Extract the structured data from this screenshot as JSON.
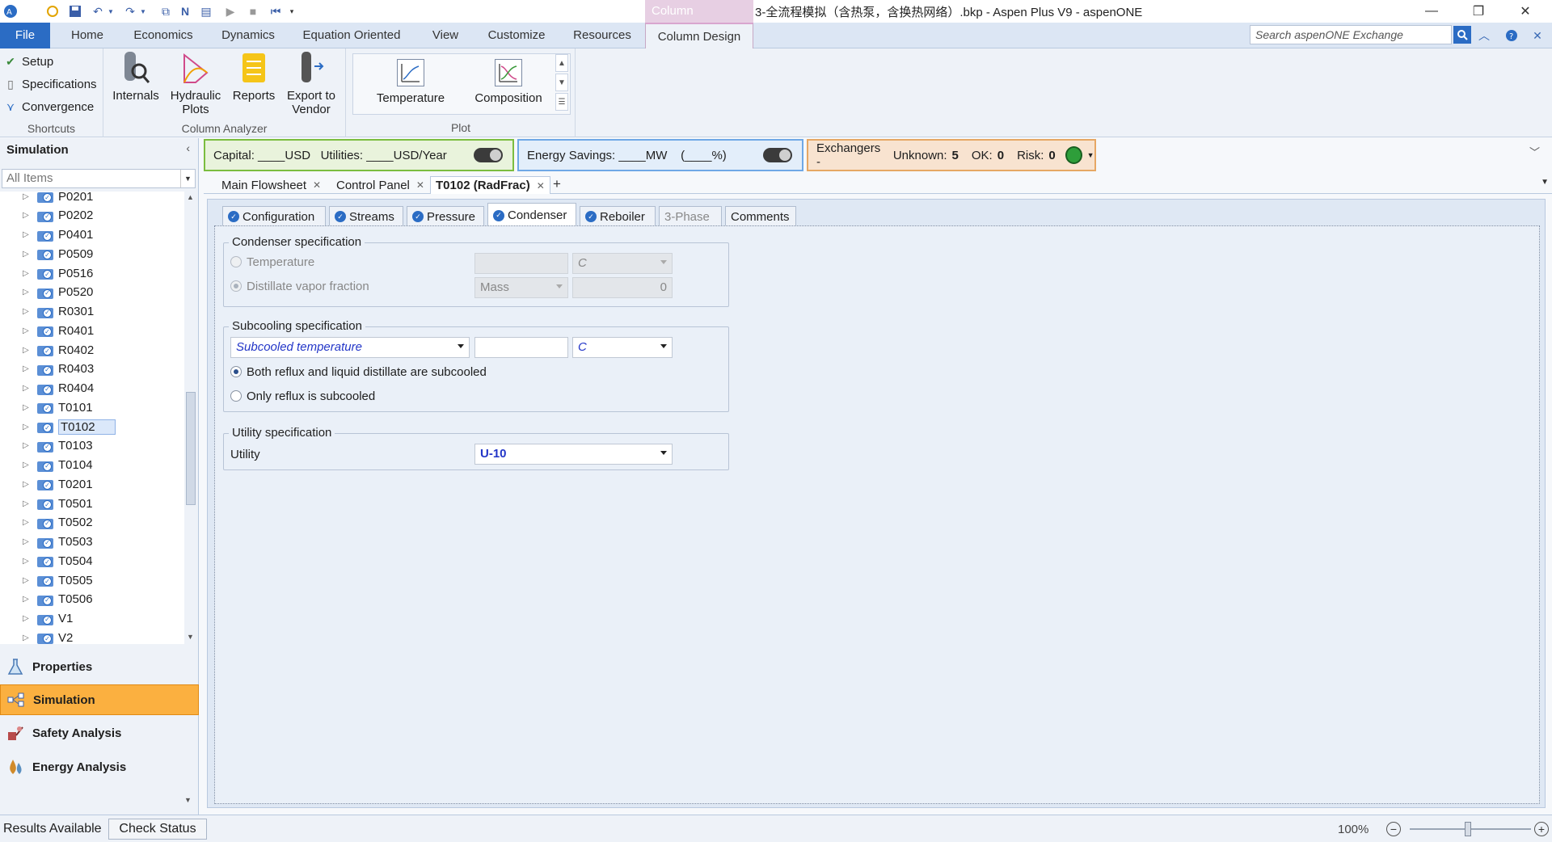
{
  "titlebar": {
    "context_tab": "Column",
    "window_title": "3-全流程模拟（含热泵，含换热网络）.bkp - Aspen Plus V9 - aspenONE",
    "quick_access_icons": [
      "aspen-logo-icon",
      "new-icon",
      "save-icon",
      "undo-icon",
      "undo-dropdown-icon",
      "redo-icon",
      "redo-dropdown-icon",
      "flowsheet-icon",
      "next-icon",
      "control-panel-icon",
      "run-icon",
      "stop-icon",
      "reset-icon",
      "customize-qat-icon"
    ]
  },
  "ribbon_tabs": {
    "file": "File",
    "home": "Home",
    "economics": "Economics",
    "dynamics": "Dynamics",
    "equation_oriented": "Equation Oriented",
    "view": "View",
    "customize": "Customize",
    "resources": "Resources",
    "column_design": "Column Design",
    "search_placeholder": "Search aspenONE Exchange"
  },
  "ribbon": {
    "shortcuts": {
      "setup": "Setup",
      "specifications": "Specifications",
      "convergence": "Convergence",
      "label": "Shortcuts"
    },
    "column_analyzer": {
      "internals": "Internals",
      "hydraulic_plots": "Hydraulic\nPlots",
      "reports": "Reports",
      "export_to_vendor": "Export to\nVendor",
      "label": "Column Analyzer"
    },
    "plot": {
      "temperature": "Temperature",
      "composition": "Composition",
      "label": "Plot"
    }
  },
  "nav": {
    "title": "Simulation",
    "filter": "All Items",
    "tree_items": [
      "P0201",
      "P0202",
      "P0401",
      "P0509",
      "P0516",
      "P0520",
      "R0301",
      "R0401",
      "R0402",
      "R0403",
      "R0404",
      "T0101",
      "T0102",
      "T0103",
      "T0104",
      "T0201",
      "T0501",
      "T0502",
      "T0503",
      "T0504",
      "T0505",
      "T0506",
      "V1",
      "V2"
    ],
    "selected": "T0102",
    "panes": {
      "properties": "Properties",
      "simulation": "Simulation",
      "safety": "Safety Analysis",
      "energy": "Energy Analysis"
    }
  },
  "banner": {
    "capital": "Capital: ____USD   Utilities: ____USD/Year",
    "energy": "Energy Savings: ____MW    (____%)",
    "hx_prefix": "Exchangers -",
    "hx_unknown_label": "Unknown:",
    "hx_unknown": "5",
    "hx_ok_label": "OK:",
    "hx_ok": "0",
    "hx_risk_label": "Risk:",
    "hx_risk": "0"
  },
  "doc_tabs": {
    "main_flowsheet": "Main Flowsheet",
    "control_panel": "Control Panel",
    "active": "T0102 (RadFrac)"
  },
  "form_tabs": {
    "configuration": "Configuration",
    "streams": "Streams",
    "pressure": "Pressure",
    "condenser": "Condenser",
    "reboiler": "Reboiler",
    "three_phase": "3-Phase",
    "comments": "Comments"
  },
  "condenser_spec": {
    "title": "Condenser specification",
    "temperature_label": "Temperature",
    "temperature_value": "",
    "temperature_unit": "C",
    "dvf_label": "Distillate vapor fraction",
    "dvf_basis": "Mass",
    "dvf_value": "0"
  },
  "subcooling_spec": {
    "title": "Subcooling specification",
    "type": "Subcooled temperature",
    "value": "",
    "unit": "C",
    "option_both": "Both reflux and liquid distillate are subcooled",
    "option_reflux": "Only reflux is subcooled"
  },
  "utility_spec": {
    "title": "Utility specification",
    "label": "Utility",
    "value": "U-10"
  },
  "statusbar": {
    "status": "Results Available",
    "check_status": "Check Status",
    "zoom": "100%"
  }
}
